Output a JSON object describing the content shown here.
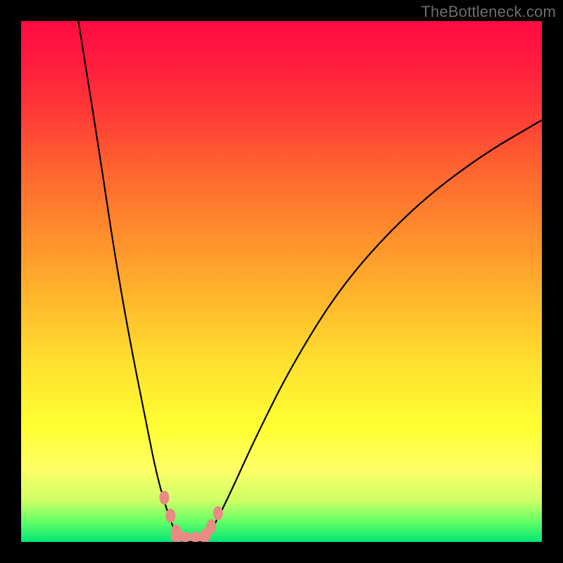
{
  "watermark": "TheBottleneck.com",
  "chart_data": {
    "type": "line",
    "title": "",
    "xlabel": "",
    "ylabel": "",
    "xlim": [
      0,
      100
    ],
    "ylim": [
      0,
      100
    ],
    "grid": false,
    "legend": false,
    "background": "red-to-green-vertical-gradient",
    "left_curve": {
      "x": [
        11,
        15,
        18,
        21,
        24,
        26,
        28,
        29.5,
        31
      ],
      "y": [
        100,
        75,
        55,
        38,
        23,
        13,
        6,
        2,
        0
      ]
    },
    "right_curve": {
      "x": [
        35,
        37,
        40,
        45,
        52,
        62,
        75,
        88,
        100
      ],
      "y": [
        0,
        3,
        9,
        20,
        34,
        50,
        64,
        74,
        81
      ]
    },
    "bottom_segment": {
      "x": [
        31,
        35
      ],
      "y": [
        0,
        0
      ]
    },
    "markers_left": {
      "x": [
        27.5,
        28.7,
        29.8
      ],
      "y": [
        8.5,
        5.0,
        2.0
      ]
    },
    "markers_right": {
      "x": [
        35.5,
        36.5,
        37.8
      ],
      "y": [
        1.3,
        3.0,
        5.5
      ]
    },
    "note": "y=0 is green (no bottleneck), y=100 is red (max bottleneck). Curve dips to 0 near x≈31–35."
  }
}
